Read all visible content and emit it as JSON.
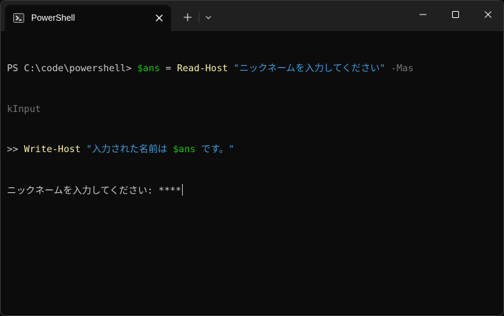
{
  "window": {
    "tab_title": "PowerShell",
    "icons": {
      "tab": "powershell-icon",
      "close_tab": "close-icon",
      "new_tab": "plus-icon",
      "dropdown": "chevron-down-icon",
      "minimize": "minimize-icon",
      "maximize": "maximize-icon",
      "close": "close-icon"
    }
  },
  "colors": {
    "background": "#0c0c0c",
    "titlebar": "#202020",
    "text": "#cccccc",
    "variable": "#16c60c",
    "command": "#f9f1a5",
    "string": "#3b9fdf",
    "parameter": "#767676"
  },
  "terminal": {
    "line1": {
      "prompt": "PS C:\\code\\powershell> ",
      "var": "$ans",
      "op": " = ",
      "cmd": "Read-Host",
      "str": " \"ニックネームを入力してください\"",
      "param_a": " -Mas"
    },
    "line2": {
      "param_b": "kInput"
    },
    "line3": {
      "prompt": ">> ",
      "cmd": "Write-Host",
      "str_a": " \"入力された名前は ",
      "var": "$ans",
      "str_b": " です。\""
    },
    "line4": {
      "text": "ニックネームを入力してください: ****"
    }
  }
}
